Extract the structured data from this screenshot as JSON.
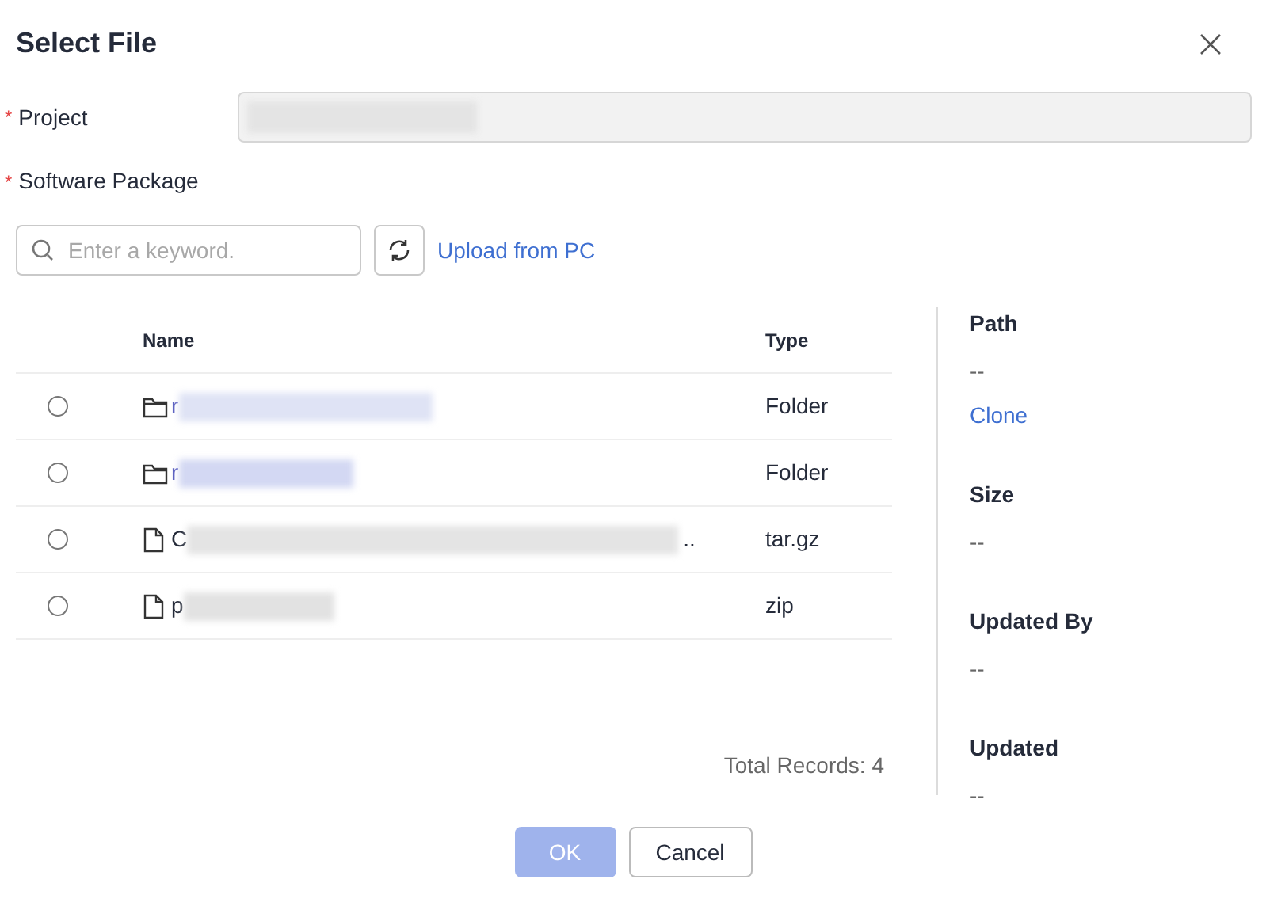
{
  "dialog": {
    "title": "Select File"
  },
  "project": {
    "label": "Project",
    "required_mark": "*"
  },
  "package": {
    "label": "Software Package",
    "required_mark": "*"
  },
  "search": {
    "placeholder": "Enter a keyword."
  },
  "upload_link": "Upload from PC",
  "table": {
    "columns": [
      "Name",
      "Type"
    ],
    "rows": [
      {
        "kind": "folder",
        "name": "r",
        "type": "Folder",
        "selected": false
      },
      {
        "kind": "folder",
        "name": "r",
        "type": "Folder",
        "selected": false
      },
      {
        "kind": "file",
        "name": "C",
        "trail": "..",
        "type": "tar.gz",
        "selected": false
      },
      {
        "kind": "file",
        "name": "p",
        "type": "zip",
        "selected": false
      }
    ],
    "total": "Total Records: 4"
  },
  "details": [
    {
      "label": "Path",
      "value": "--",
      "link": "Clone"
    },
    {
      "label": "Size",
      "value": "--"
    },
    {
      "label": "Updated By",
      "value": "--"
    },
    {
      "label": "Updated",
      "value": "--"
    }
  ],
  "buttons": [
    {
      "label": "OK",
      "kind": "primary",
      "disabled": true
    },
    {
      "label": "Cancel",
      "kind": "secondary",
      "disabled": false
    }
  ]
}
